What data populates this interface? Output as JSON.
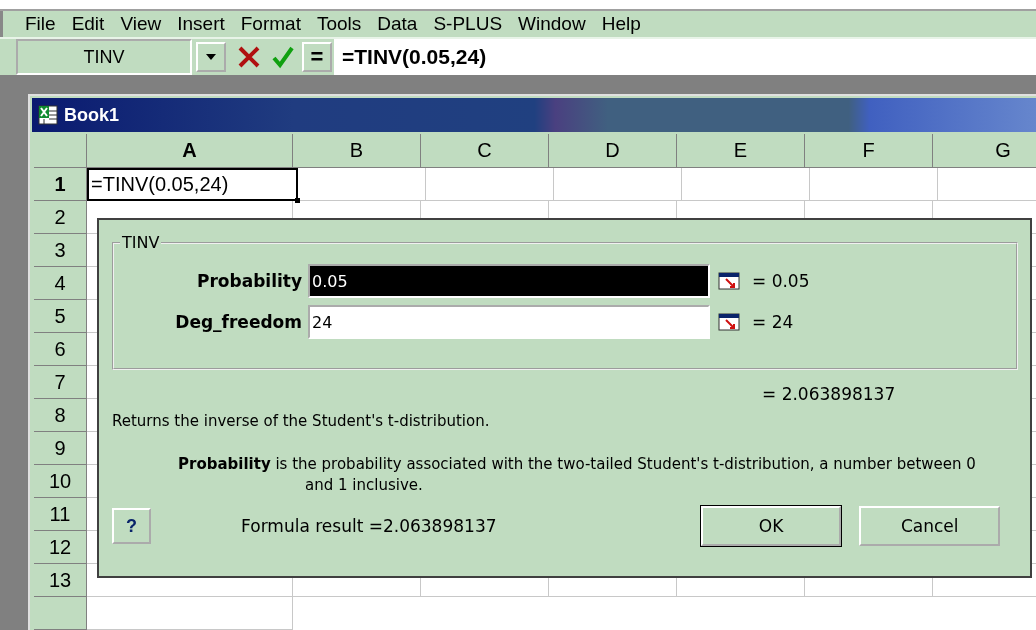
{
  "menu": [
    "File",
    "Edit",
    "View",
    "Insert",
    "Format",
    "Tools",
    "Data",
    "S-PLUS",
    "Window",
    "Help"
  ],
  "formula_bar": {
    "name_box": "TINV",
    "equals_button": "=",
    "formula": "=TINV(0.05,24)"
  },
  "workbook": {
    "title": "Book1",
    "columns": [
      {
        "label": "A",
        "selected": true
      },
      {
        "label": "B",
        "selected": false
      },
      {
        "label": "C",
        "selected": false
      },
      {
        "label": "D",
        "selected": false
      },
      {
        "label": "E",
        "selected": false
      },
      {
        "label": "F",
        "selected": false
      },
      {
        "label": "G",
        "selected": false
      }
    ],
    "rows": [
      {
        "label": "1",
        "selected": true
      },
      {
        "label": "2",
        "selected": false
      },
      {
        "label": "3",
        "selected": false
      },
      {
        "label": "4",
        "selected": false
      },
      {
        "label": "5",
        "selected": false
      },
      {
        "label": "6",
        "selected": false
      },
      {
        "label": "7",
        "selected": false
      },
      {
        "label": "8",
        "selected": false
      },
      {
        "label": "9",
        "selected": false
      },
      {
        "label": "10",
        "selected": false
      },
      {
        "label": "11",
        "selected": false
      },
      {
        "label": "12",
        "selected": false
      },
      {
        "label": "13",
        "selected": false
      }
    ],
    "active_cell": "=TINV(0.05,24)"
  },
  "dialog": {
    "group_title": "TINV",
    "arguments": [
      {
        "label": "Probability",
        "value": "0.05",
        "selected": true,
        "result": "= 0.05"
      },
      {
        "label": "Deg_freedom",
        "value": "24",
        "selected": false,
        "result": "= 24"
      }
    ],
    "result": "= 2.063898137",
    "description": "Returns the inverse of the Student's t-distribution.",
    "argument_help": "**Probability** is the probability associated with the two-tailed Student's t-distribution, a number between 0 and 1 inclusive.",
    "help_button": "?",
    "formula_result": "Formula result =2.063898137",
    "buttons": [
      "OK",
      "Cancel"
    ]
  }
}
